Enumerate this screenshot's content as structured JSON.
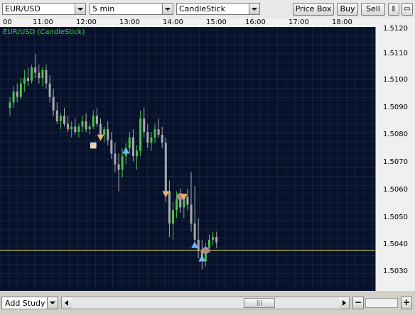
{
  "toolbar": {
    "symbol": "EUR/USD",
    "interval": "5 min",
    "chart_style": "CandleStick",
    "price_box_label": "Price Box",
    "buy_label": "Buy",
    "sell_label": "Sell"
  },
  "chart": {
    "legend": "EUR/USD (CandleStick)",
    "time_labels": [
      "00",
      "11:00",
      "12:00",
      "13:00",
      "14:00",
      "15:00",
      "16:00",
      "17:00",
      "18:00"
    ],
    "price_labels": [
      "1.5110",
      "1.5100",
      "1.5090",
      "1.5080",
      "1.5070",
      "1.5060",
      "1.5050",
      "1.5040",
      "1.5030"
    ],
    "reference_line_price": 1.504,
    "colors": {
      "background": "#07122a",
      "grid": "#1e2f52",
      "up": "#49c04a",
      "down": "#a8a8a8",
      "reference_line": "#e8e85a"
    }
  },
  "bottom": {
    "add_study_label": "Add Study",
    "zoom_out_label": "−",
    "zoom_in_label": "+"
  },
  "chart_data": {
    "type": "candlestick",
    "x_start": "10:00",
    "interval": "5 min",
    "ylim": [
      1.5025,
      1.5125
    ],
    "candles": [
      [
        1.5093,
        1.5097,
        1.509,
        1.5095
      ],
      [
        1.5095,
        1.5101,
        1.5093,
        1.5099
      ],
      [
        1.5099,
        1.5102,
        1.5095,
        1.5097
      ],
      [
        1.5097,
        1.5104,
        1.5096,
        1.5102
      ],
      [
        1.5102,
        1.5107,
        1.5099,
        1.5104
      ],
      [
        1.5104,
        1.5108,
        1.5101,
        1.5103
      ],
      [
        1.5103,
        1.5109,
        1.5102,
        1.5108
      ],
      [
        1.5108,
        1.5113,
        1.5104,
        1.5106
      ],
      [
        1.5106,
        1.5109,
        1.5102,
        1.5104
      ],
      [
        1.5104,
        1.5108,
        1.5101,
        1.5107
      ],
      [
        1.5107,
        1.5109,
        1.51,
        1.5102
      ],
      [
        1.5102,
        1.5105,
        1.5095,
        1.5097
      ],
      [
        1.5097,
        1.51,
        1.509,
        1.5092
      ],
      [
        1.5092,
        1.5095,
        1.5087,
        1.5088
      ],
      [
        1.5088,
        1.5091,
        1.5085,
        1.509
      ],
      [
        1.509,
        1.5093,
        1.5086,
        1.5087
      ],
      [
        1.5087,
        1.509,
        1.5084,
        1.5085
      ],
      [
        1.5085,
        1.5088,
        1.5082,
        1.5086
      ],
      [
        1.5086,
        1.5089,
        1.5083,
        1.5084
      ],
      [
        1.5084,
        1.5087,
        1.5082,
        1.5086
      ],
      [
        1.5086,
        1.509,
        1.5084,
        1.5088
      ],
      [
        1.5088,
        1.5091,
        1.5084,
        1.5085
      ],
      [
        1.5085,
        1.5087,
        1.5083,
        1.5086
      ],
      [
        1.5086,
        1.5092,
        1.5085,
        1.509
      ],
      [
        1.509,
        1.5093,
        1.5086,
        1.5087
      ],
      [
        1.5087,
        1.5089,
        1.5082,
        1.5083
      ],
      [
        1.5083,
        1.5086,
        1.508,
        1.5085
      ],
      [
        1.5085,
        1.5088,
        1.5079,
        1.5081
      ],
      [
        1.5081,
        1.5084,
        1.5074,
        1.5076
      ],
      [
        1.5076,
        1.508,
        1.5069,
        1.5072
      ],
      [
        1.5072,
        1.5076,
        1.5062,
        1.507
      ],
      [
        1.507,
        1.5078,
        1.5067,
        1.5075
      ],
      [
        1.5075,
        1.508,
        1.5072,
        1.5078
      ],
      [
        1.5078,
        1.5084,
        1.5076,
        1.5082
      ],
      [
        1.5082,
        1.5085,
        1.5073,
        1.5075
      ],
      [
        1.5075,
        1.5079,
        1.507,
        1.5077
      ],
      [
        1.5077,
        1.5092,
        1.5075,
        1.5089
      ],
      [
        1.5089,
        1.5093,
        1.5082,
        1.5084
      ],
      [
        1.5084,
        1.5087,
        1.5078,
        1.508
      ],
      [
        1.508,
        1.5084,
        1.5077,
        1.5082
      ],
      [
        1.5082,
        1.5087,
        1.508,
        1.5085
      ],
      [
        1.5085,
        1.5089,
        1.5082,
        1.5083
      ],
      [
        1.5083,
        1.5086,
        1.5078,
        1.508
      ],
      [
        1.508,
        1.5082,
        1.5058,
        1.5062
      ],
      [
        1.5062,
        1.5066,
        1.5045,
        1.505
      ],
      [
        1.505,
        1.5058,
        1.5044,
        1.5055
      ],
      [
        1.5055,
        1.5062,
        1.5052,
        1.5059
      ],
      [
        1.5059,
        1.5063,
        1.5054,
        1.5056
      ],
      [
        1.5056,
        1.5061,
        1.5052,
        1.506
      ],
      [
        1.506,
        1.5063,
        1.5055,
        1.5057
      ],
      [
        1.5057,
        1.5069,
        1.5047,
        1.505
      ],
      [
        1.505,
        1.5064,
        1.5041,
        1.5044
      ],
      [
        1.5044,
        1.5052,
        1.5037,
        1.504
      ],
      [
        1.504,
        1.5044,
        1.5033,
        1.5036
      ],
      [
        1.5036,
        1.5043,
        1.5034,
        1.5041
      ],
      [
        1.5041,
        1.5046,
        1.5039,
        1.5044
      ],
      [
        1.5044,
        1.5047,
        1.5042,
        1.5045
      ],
      [
        1.5045,
        1.5047,
        1.5041,
        1.5043
      ]
    ],
    "markers": [
      {
        "type": "square",
        "color": "#f2d49a",
        "x_index": 23,
        "price": 1.5079
      },
      {
        "type": "triangle-down",
        "color": "#f0b070",
        "x_index": 25,
        "price": 1.5082
      },
      {
        "type": "triangle-up",
        "color": "#6fb6ff",
        "x_index": 32,
        "price": 1.5077
      },
      {
        "type": "triangle-down",
        "color": "#f0b070",
        "x_index": 43,
        "price": 1.5061
      },
      {
        "type": "circle",
        "color": "#b38a86",
        "x_index": 47,
        "price": 1.506
      },
      {
        "type": "triangle-down",
        "color": "#f0b070",
        "x_index": 48,
        "price": 1.506
      },
      {
        "type": "triangle-up",
        "color": "#6fb6ff",
        "x_index": 51,
        "price": 1.5042
      },
      {
        "type": "triangle-up",
        "color": "#6fb6ff",
        "x_index": 53,
        "price": 1.5037
      },
      {
        "type": "circle",
        "color": "#b38a86",
        "x_index": 54,
        "price": 1.504
      }
    ]
  }
}
